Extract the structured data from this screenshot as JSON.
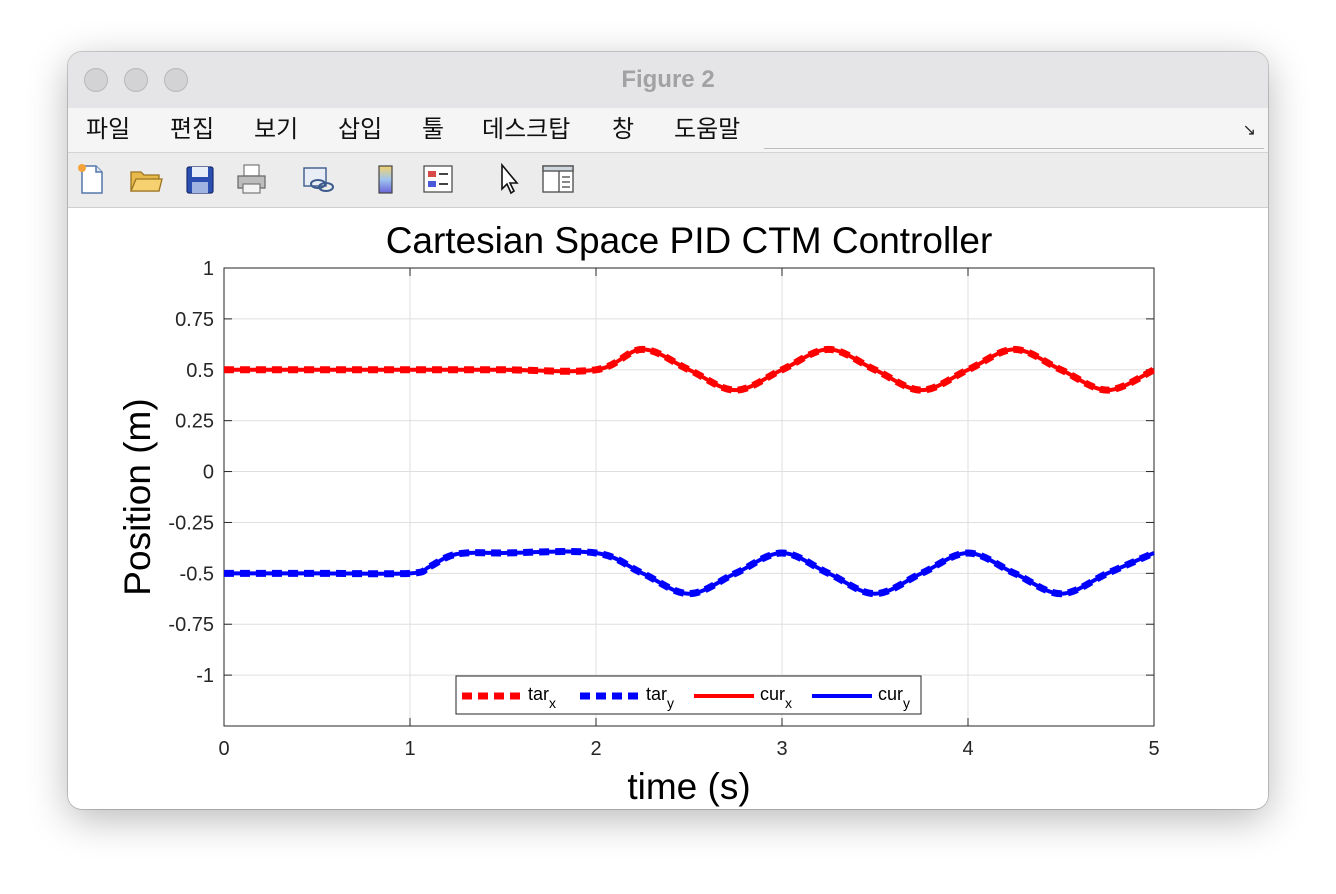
{
  "window": {
    "title": "Figure 2"
  },
  "menu": {
    "items": [
      "파일",
      "편집",
      "보기",
      "삽입",
      "툴",
      "데스크탑",
      "창",
      "도움말"
    ]
  },
  "toolbar": {
    "buttons": [
      "new-figure-icon",
      "open-file-icon",
      "save-icon",
      "print-icon",
      "link-plot-icon",
      "colorbar-icon",
      "legend-icon",
      "edit-plot-cursor-icon",
      "property-inspector-icon"
    ]
  },
  "chart_data": {
    "type": "line",
    "title": "Cartesian Space PID CTM Controller",
    "xlabel": "time (s)",
    "ylabel": "Position (m)",
    "xlim": [
      0,
      5
    ],
    "ylim": [
      -1.25,
      1
    ],
    "xticks": [
      "0",
      "1",
      "2",
      "3",
      "4",
      "5"
    ],
    "yticks": [
      "1",
      "0.75",
      "0.5",
      "0.25",
      "0",
      "-0.25",
      "-0.5",
      "-0.75",
      "-1"
    ],
    "grid": true,
    "legend_position": "bottom-center",
    "legend": [
      {
        "base": "tar",
        "sub": "x"
      },
      {
        "base": "tar",
        "sub": "y"
      },
      {
        "base": "cur",
        "sub": "x"
      },
      {
        "base": "cur",
        "sub": "y"
      }
    ],
    "series": [
      {
        "name": "tar_x",
        "color": "#ff0000",
        "style": "dashed",
        "x": [
          0,
          0.5,
          1,
          1.5,
          2,
          2.25,
          2.5,
          2.75,
          3,
          3.25,
          3.5,
          3.75,
          4,
          4.25,
          4.5,
          4.75,
          5
        ],
        "y": [
          0.5,
          0.5,
          0.5,
          0.5,
          0.5,
          0.6,
          0.5,
          0.4,
          0.5,
          0.6,
          0.5,
          0.4,
          0.5,
          0.6,
          0.5,
          0.4,
          0.5
        ]
      },
      {
        "name": "tar_y",
        "color": "#0000ff",
        "style": "dashed",
        "x": [
          0,
          0.5,
          1,
          1.1,
          1.2,
          1.3,
          1.5,
          2,
          2.25,
          2.5,
          2.75,
          3,
          3.25,
          3.5,
          3.75,
          4,
          4.25,
          4.5,
          4.75,
          5
        ],
        "y": [
          -0.5,
          -0.5,
          -0.5,
          -0.47,
          -0.42,
          -0.4,
          -0.4,
          -0.4,
          -0.5,
          -0.6,
          -0.5,
          -0.4,
          -0.5,
          -0.6,
          -0.5,
          -0.4,
          -0.5,
          -0.6,
          -0.5,
          -0.4
        ]
      },
      {
        "name": "cur_x",
        "color": "#ff0000",
        "style": "solid",
        "x": [
          0,
          0.5,
          1,
          1.5,
          2,
          2.25,
          2.5,
          2.75,
          3,
          3.25,
          3.5,
          3.75,
          4,
          4.25,
          4.5,
          4.75,
          5
        ],
        "y": [
          0.5,
          0.5,
          0.5,
          0.5,
          0.5,
          0.6,
          0.5,
          0.4,
          0.5,
          0.6,
          0.5,
          0.4,
          0.5,
          0.6,
          0.5,
          0.4,
          0.5
        ]
      },
      {
        "name": "cur_y",
        "color": "#0000ff",
        "style": "solid",
        "x": [
          0,
          0.5,
          1,
          1.1,
          1.2,
          1.3,
          1.5,
          2,
          2.25,
          2.5,
          2.75,
          3,
          3.25,
          3.5,
          3.75,
          4,
          4.25,
          4.5,
          4.75,
          5
        ],
        "y": [
          -0.5,
          -0.5,
          -0.5,
          -0.47,
          -0.42,
          -0.4,
          -0.4,
          -0.4,
          -0.5,
          -0.6,
          -0.5,
          -0.4,
          -0.5,
          -0.6,
          -0.5,
          -0.4,
          -0.5,
          -0.6,
          -0.5,
          -0.4
        ]
      }
    ]
  }
}
